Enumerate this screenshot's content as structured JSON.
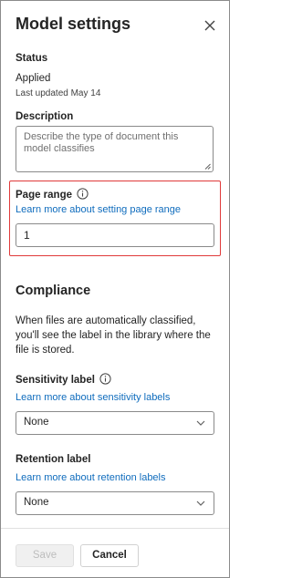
{
  "panel": {
    "title": "Model settings"
  },
  "status": {
    "label": "Status",
    "value": "Applied",
    "updated": "Last updated May 14"
  },
  "description": {
    "label": "Description",
    "placeholder": "Describe the type of document this model classifies"
  },
  "page_range": {
    "label": "Page range",
    "link": "Learn more about setting page range",
    "value": "1"
  },
  "compliance": {
    "heading": "Compliance",
    "text": "When files are automatically classified, you'll see the label in the library where the file is stored."
  },
  "sensitivity": {
    "label": "Sensitivity label",
    "link": "Learn more about sensitivity labels",
    "selected": "None"
  },
  "retention": {
    "label": "Retention label",
    "link": "Learn more about retention labels",
    "selected": "None"
  },
  "footer": {
    "save": "Save",
    "cancel": "Cancel"
  },
  "icons": {
    "close": "close-icon",
    "info": "info-icon",
    "chevron": "chevron-down-icon",
    "resize": "resize-grip-icon"
  },
  "colors": {
    "link": "#0f6cbd",
    "highlight": "#e03a3a"
  }
}
